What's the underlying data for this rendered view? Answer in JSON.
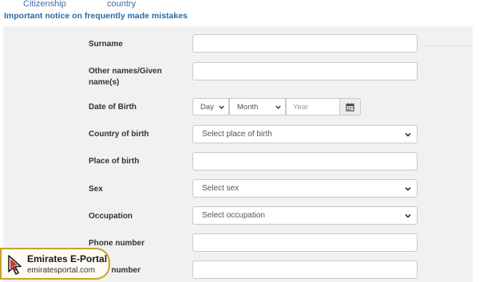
{
  "header": {
    "crumb_left": "Citizenship",
    "crumb_right": "country",
    "notice_link": "Important notice on frequently made mistakes"
  },
  "form": {
    "surname_label": "Surname",
    "surname_value": "",
    "other_names_label_line1": "Other names/Given",
    "other_names_label_line2": "name(s)",
    "other_names_value": "",
    "dob_label": "Date of Birth",
    "dob_day": "Day",
    "dob_month": "Month",
    "dob_year_placeholder": "Year",
    "country_of_birth_label": "Country of birth",
    "country_of_birth_selected": "Select place of birth",
    "place_of_birth_label": "Place of birth",
    "place_of_birth_value": "",
    "sex_label": "Sex",
    "sex_selected": "Select sex",
    "occupation_label": "Occupation",
    "occupation_selected": "Select occupation",
    "phone_label": "Phone number",
    "phone_value": "",
    "mobile_label_visible": "e number",
    "mobile_value": ""
  },
  "watermark": {
    "title": "Emirates E-Portal",
    "url": "emiratesportal.com"
  },
  "icons": {
    "calendar": "calendar-icon",
    "chevron": "chevron-down-icon",
    "logo": "cursor-logo-icon"
  },
  "colors": {
    "link_blue": "#3f6fa8",
    "panel_bg": "#f1f1f1",
    "logo_gold": "#c9a227",
    "logo_red": "#d32f2f"
  }
}
